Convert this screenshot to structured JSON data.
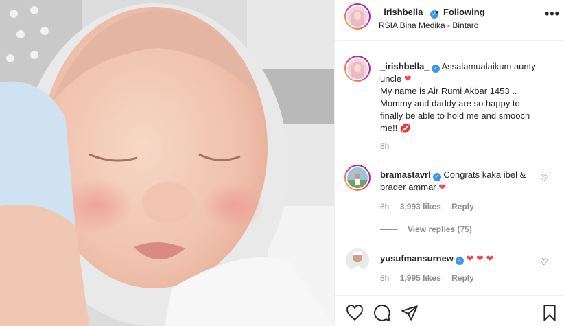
{
  "post": {
    "username": "_irishbella_",
    "follow_separator": "•",
    "follow_status": "Following",
    "location": "RSIA Bina Medika - Bintaro",
    "more_icon": "more-options-icon"
  },
  "caption": {
    "username": "_irishbella_",
    "text_line1": "Assalamualaikum aunty uncle",
    "text_line2": "My name is Air Rumi Akbar 1453 ..",
    "text_line3": "Mommy and daddy are so happy to finally be able to hold me and smooch me!!",
    "emoji_heart": "❤",
    "emoji_lips": "💋",
    "time": "8h"
  },
  "comments": [
    {
      "username": "bramastavrl",
      "text": "Congrats kaka ibel & brader ammar",
      "emoji": "❤",
      "time": "8h",
      "likes": "3,993 likes",
      "reply": "Reply"
    },
    {
      "username": "yusufmansurnew",
      "text": "",
      "emoji": "❤ ❤ ❤",
      "time": "8h",
      "likes": "1,995 likes",
      "reply": "Reply"
    }
  ],
  "view_replies": "View replies (75)",
  "colors": {
    "accent_blue": "#3897f0",
    "heart_red": "#ed4956",
    "muted": "#8e8e8e"
  }
}
